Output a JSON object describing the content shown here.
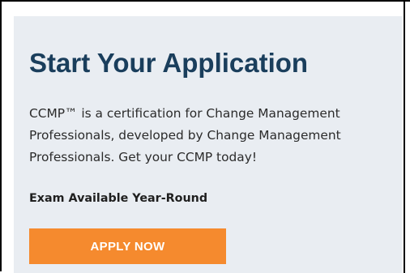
{
  "card": {
    "title": "Start Your Application",
    "description": "CCMP™ is a certification for Change Management Professionals, developed by Change Management Professionals. Get your CCMP today!",
    "highlight": "Exam Available Year-Round",
    "button_label": "APPLY NOW"
  },
  "colors": {
    "card_background": "#e9edf2",
    "title": "#1a3e5c",
    "button_background": "#f58a2e",
    "button_text": "#ffffff"
  }
}
